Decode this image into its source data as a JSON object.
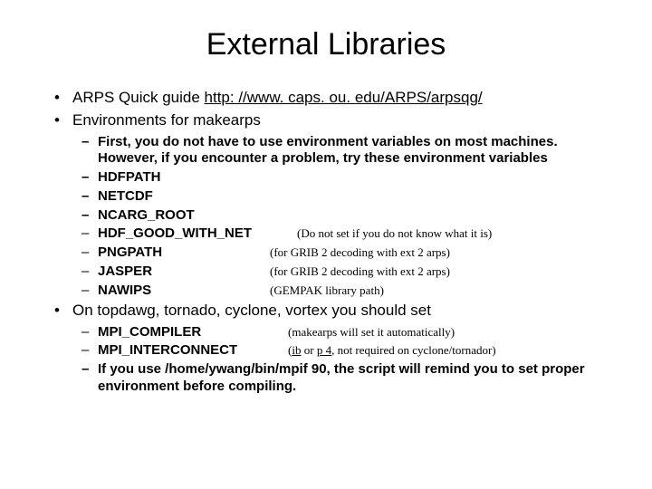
{
  "title": "External Libraries",
  "b1_label": "ARPS Quick guide ",
  "b1_link": "http: //www. caps. ou. edu/ARPS/arpsqg/",
  "b2": "Environments for makearps",
  "env": {
    "first": "First, you do not have to use environment variables on most machines. However, if you encounter a problem, try these environment variables",
    "hdfpath": "HDFPATH",
    "netcdf": "NETCDF",
    "ncarg": "NCARG_ROOT",
    "hdfgood": "HDF_GOOD_WITH_NET",
    "hdfgood_note": "(Do not set if you do not know what it is)",
    "pngpath": "PNGPATH",
    "pngpath_note": "(for GRIB 2 decoding with ext 2 arps)",
    "jasper": "JASPER",
    "jasper_note": "(for GRIB 2 decoding with ext 2 arps)",
    "nawips": "NAWIPS",
    "nawips_note": "(GEMPAK library path)"
  },
  "b3": "On topdawg, tornado, cyclone, vortex you should set",
  "set": {
    "mpicomp": "MPI_COMPILER",
    "mpicomp_note": "(makearps will set it automatically)",
    "mpiinter": "MPI_INTERCONNECT",
    "mpiinter_note_pre": "(",
    "mpiinter_ib": "ib",
    "mpiinter_or": " or ",
    "mpiinter_p4": "p 4",
    "mpiinter_note_post": ", not required on cyclone/tornador)",
    "mpif90": "If you use /home/ywang/bin/mpif 90, the script will remind you to set proper environment before compiling."
  }
}
